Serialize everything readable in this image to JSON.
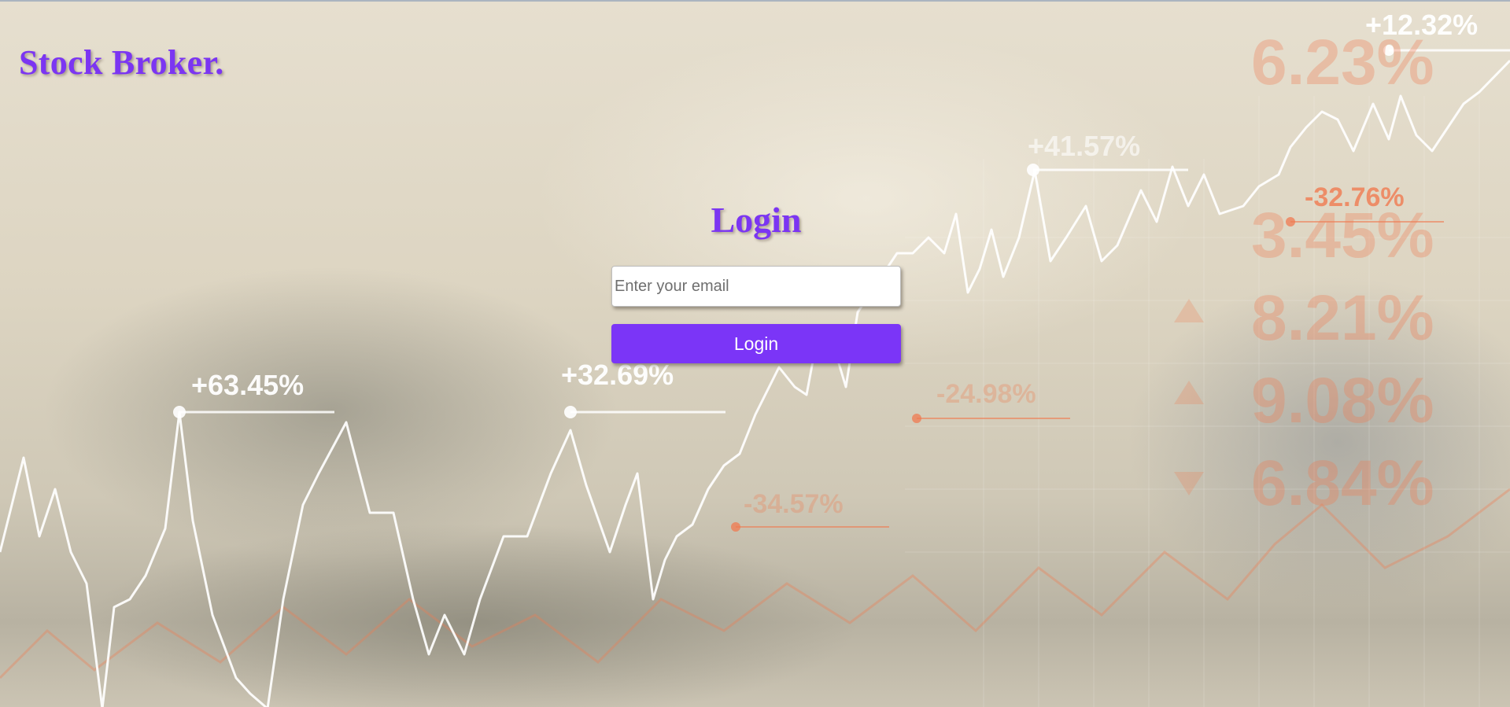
{
  "brand": {
    "name": "Stock Broker."
  },
  "login": {
    "title": "Login",
    "email_placeholder": "Enter your email",
    "email_value": "",
    "button_label": "Login"
  },
  "background": {
    "labels_white": [
      "+63.45%",
      "+32.69%",
      "+41.57%",
      "+12.32%"
    ],
    "labels_orange": [
      "-32.76%",
      "-34.57%",
      "-24.98%",
      "6.23%",
      "3.45%",
      "8.21%",
      "9.08%",
      "6.84%"
    ],
    "colors": {
      "line": "#ffffff",
      "orange": "#f07a50",
      "accent": "#7b35f2"
    }
  }
}
